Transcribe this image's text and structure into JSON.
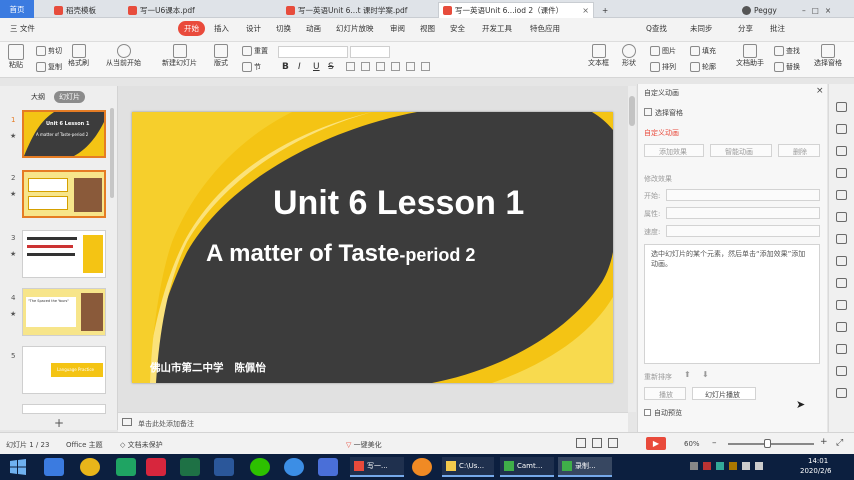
{
  "tabs": {
    "home": "首页",
    "items": [
      {
        "label": "稻壳模板",
        "color": "#e74c3c"
      },
      {
        "label": "写一U6课本.pdf",
        "color": "#e74c3c"
      },
      {
        "label": "写一英语Unit 6...t 课时学案.pdf",
        "color": "#e74c3c"
      },
      {
        "label": "写一英语Unit 6...iod 2（课件）",
        "color": "#e74c3c"
      }
    ],
    "add": "+",
    "user": "Peggy"
  },
  "menu": {
    "file": "三 文件",
    "items": [
      "开始",
      "插入",
      "设计",
      "切换",
      "动画",
      "幻灯片放映",
      "审阅",
      "视图",
      "安全",
      "开发工具",
      "特色应用",
      "Q查找"
    ],
    "active": "开始",
    "sync": "未同步",
    "share": "分享",
    "comment": "批注"
  },
  "ribbon": {
    "paste": "粘贴",
    "cut": "剪切",
    "copy": "复制",
    "format_painter": "格式刷",
    "from_current": "从当前开始",
    "new_slide": "新建幻灯片",
    "layout": "版式",
    "reset": "重置",
    "section": "节",
    "textbox": "文本框",
    "shape": "形状",
    "arrange": "排列",
    "picture": "图片",
    "fill": "填充",
    "outline": "轮廓",
    "find": "查找",
    "replace": "替换",
    "doc_assist": "文档助手",
    "select_pane": "选择窗格",
    "bold": "B",
    "italic": "I",
    "underline": "U",
    "strike": "S"
  },
  "leftpanel": {
    "tab_outline": "大纲",
    "tab_slides": "幻灯片",
    "slide_numbers": [
      "1",
      "2",
      "3",
      "4",
      "5"
    ],
    "add_slide": "+",
    "thumb_titles": {
      "s1_line1": "Unit 6 Lesson 1",
      "s1_line2": "A matter of Taste-period 2",
      "s4_line1": "\"The Spaced the Yours\"",
      "s5_label": "Language Practice"
    }
  },
  "slide": {
    "title": "Unit 6 Lesson 1",
    "subtitle_main": "A matter of Taste",
    "subtitle_suffix": "-period 2",
    "author": "佛山市第二中学   陈佩怡"
  },
  "notes": {
    "placeholder": "单击此处添加备注"
  },
  "rightpane": {
    "header": "自定义动画",
    "select_pane": "选择窗格",
    "section": "自定义动画",
    "add_effect": "添加效果",
    "smart_anim": "智能动画",
    "delete": "删除",
    "modify": "修改效果",
    "start": "开始:",
    "property": "属性:",
    "speed": "速度:",
    "hint": "选中幻灯片的某个元素，然后单击“添加效果”添加动画。",
    "reorder": "重新排序",
    "play": "播放",
    "slideshow": "幻灯片播放",
    "autopreview": "自动预览"
  },
  "status": {
    "slide_count": "幻灯片 1 / 23",
    "theme": "Office 主题",
    "protect": "文档未保护",
    "beautify": "一键美化",
    "zoom": "60%",
    "zoom_level": 0.6
  },
  "taskbar": {
    "windows": [
      "写一...",
      "C:\\Us...",
      "Camt...",
      "录制..."
    ],
    "time": "14:01",
    "date": "2020/2/6"
  },
  "colors": {
    "accent_red": "#e94a3b",
    "slide_yellow": "#f4c414",
    "slide_dark": "#3c3c3c",
    "tab_blue": "#3b7be0"
  }
}
